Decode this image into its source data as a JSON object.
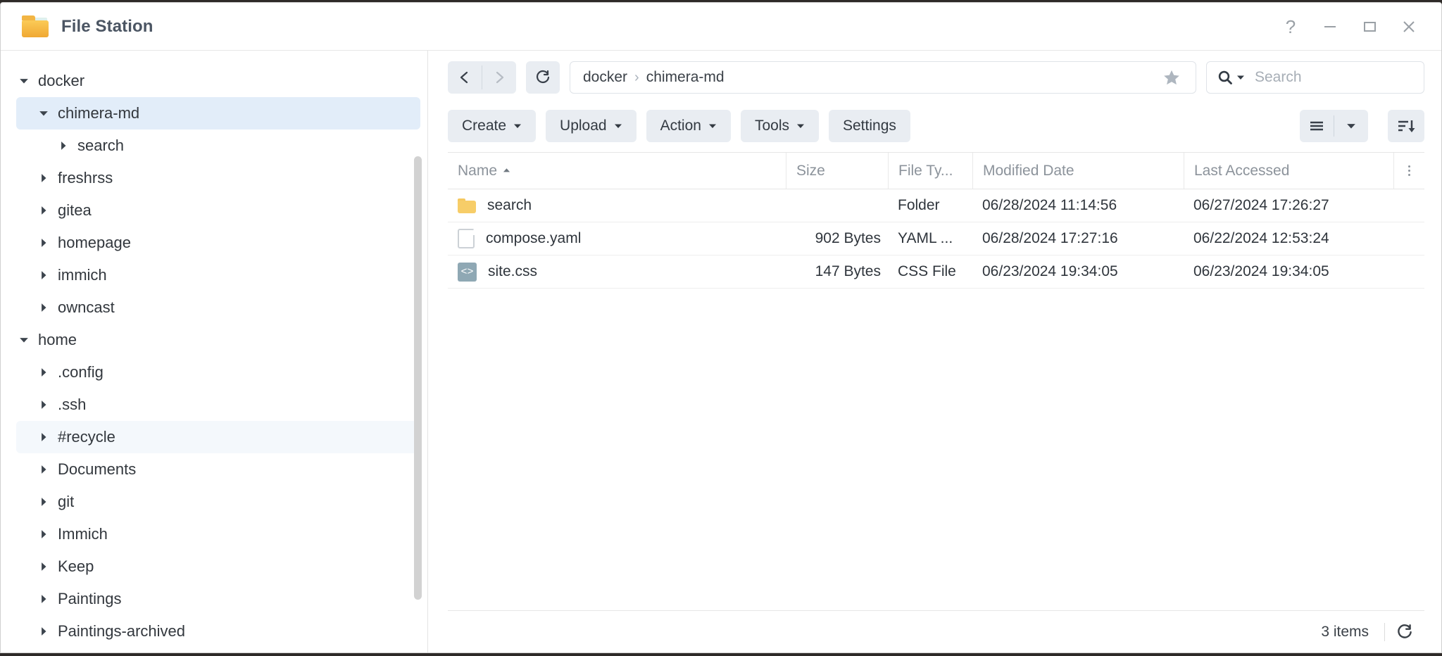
{
  "window": {
    "title": "File Station",
    "app_icon": "folder-icon",
    "controls": [
      {
        "name": "help-button",
        "icon": "question-mark-icon"
      },
      {
        "name": "minimize-button",
        "icon": "minimize-icon"
      },
      {
        "name": "maximize-button",
        "icon": "maximize-icon"
      },
      {
        "name": "close-button",
        "icon": "close-icon"
      }
    ]
  },
  "sidebar": {
    "scrollbar": {
      "visible": true
    },
    "items": [
      {
        "label": "",
        "depth": 0,
        "twisty": "none",
        "state": "clipped"
      },
      {
        "label": "docker",
        "depth": 0,
        "twisty": "expanded",
        "state": "normal"
      },
      {
        "label": "chimera-md",
        "depth": 1,
        "twisty": "expanded",
        "state": "selected"
      },
      {
        "label": "search",
        "depth": 2,
        "twisty": "collapsed",
        "state": "normal"
      },
      {
        "label": "freshrss",
        "depth": 1,
        "twisty": "collapsed",
        "state": "normal"
      },
      {
        "label": "gitea",
        "depth": 1,
        "twisty": "collapsed",
        "state": "normal"
      },
      {
        "label": "homepage",
        "depth": 1,
        "twisty": "collapsed",
        "state": "normal"
      },
      {
        "label": "immich",
        "depth": 1,
        "twisty": "collapsed",
        "state": "normal"
      },
      {
        "label": "owncast",
        "depth": 1,
        "twisty": "collapsed",
        "state": "normal"
      },
      {
        "label": "home",
        "depth": 0,
        "twisty": "expanded",
        "state": "normal"
      },
      {
        "label": ".config",
        "depth": 1,
        "twisty": "collapsed",
        "state": "normal"
      },
      {
        "label": ".ssh",
        "depth": 1,
        "twisty": "collapsed",
        "state": "normal"
      },
      {
        "label": "#recycle",
        "depth": 1,
        "twisty": "collapsed",
        "state": "hovered"
      },
      {
        "label": "Documents",
        "depth": 1,
        "twisty": "collapsed",
        "state": "normal"
      },
      {
        "label": "git",
        "depth": 1,
        "twisty": "collapsed",
        "state": "normal"
      },
      {
        "label": "Immich",
        "depth": 1,
        "twisty": "collapsed",
        "state": "normal"
      },
      {
        "label": "Keep",
        "depth": 1,
        "twisty": "collapsed",
        "state": "normal"
      },
      {
        "label": "Paintings",
        "depth": 1,
        "twisty": "collapsed",
        "state": "normal"
      },
      {
        "label": "Paintings-archived",
        "depth": 1,
        "twisty": "collapsed",
        "state": "normal"
      }
    ]
  },
  "navbar": {
    "back_icon": "chevron-left-icon",
    "forward_icon": "chevron-right-icon",
    "forward_disabled": true,
    "refresh_icon": "refresh-icon",
    "breadcrumb": [
      "docker",
      "chimera-md"
    ],
    "breadcrumb_separator": "›",
    "favorite_icon": "star-icon",
    "search": {
      "icon": "search-icon",
      "dropdown_icon": "caret-down-icon",
      "placeholder": "Search",
      "value": ""
    }
  },
  "toolbar": {
    "buttons": [
      {
        "label": "Create",
        "has_caret": true
      },
      {
        "label": "Upload",
        "has_caret": true
      },
      {
        "label": "Action",
        "has_caret": true
      },
      {
        "label": "Tools",
        "has_caret": true
      },
      {
        "label": "Settings",
        "has_caret": false
      }
    ],
    "view_toggle_icon": "list-view-icon",
    "view_toggle_caret_icon": "caret-down-icon",
    "sort_icon": "sort-descending-icon"
  },
  "filelist": {
    "columns": [
      {
        "key": "name",
        "label": "Name",
        "sort": "asc"
      },
      {
        "key": "size",
        "label": "Size",
        "sort": "none"
      },
      {
        "key": "type",
        "label": "File Ty...",
        "sort": "none"
      },
      {
        "key": "mod",
        "label": "Modified Date",
        "sort": "none"
      },
      {
        "key": "acc",
        "label": "Last Accessed",
        "sort": "none"
      }
    ],
    "column_menu_icon": "more-options-icon",
    "rows": [
      {
        "icon": "folder-icon",
        "name": "search",
        "size": "",
        "type": "Folder",
        "modified": "06/28/2024 11:14:56",
        "accessed": "06/27/2024 17:26:27"
      },
      {
        "icon": "document-icon",
        "name": "compose.yaml",
        "size": "902 Bytes",
        "type": "YAML ...",
        "modified": "06/28/2024 17:27:16",
        "accessed": "06/22/2024 12:53:24"
      },
      {
        "icon": "code-file-icon",
        "name": "site.css",
        "size": "147 Bytes",
        "type": "CSS File",
        "modified": "06/23/2024 19:34:05",
        "accessed": "06/23/2024 19:34:05"
      }
    ]
  },
  "statusbar": {
    "count_label": "3 items",
    "refresh_icon": "refresh-icon"
  },
  "colors": {
    "selected_row": "#e2edf9",
    "hovered_row": "#f4f8fc",
    "button_bg": "#e9edf2",
    "folder_yellow": "#f7cd68",
    "code_icon": "#8fa8b4",
    "text": "#32373d",
    "muted_text": "#8c939b"
  }
}
